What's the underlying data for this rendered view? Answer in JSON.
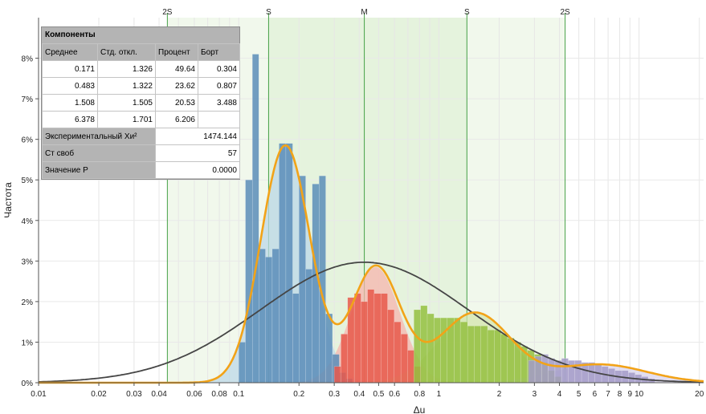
{
  "chart_data": {
    "type": "bar",
    "xlabel": "Δu",
    "ylabel": "Частота",
    "x_scale": "log",
    "xlim": [
      0.01,
      21
    ],
    "ylim": [
      0,
      9
    ],
    "y_unit": "%",
    "x_ticks": [
      {
        "v": 0.01,
        "label": "0.01"
      },
      {
        "v": 0.02,
        "label": "0.02"
      },
      {
        "v": 0.03,
        "label": "0.03"
      },
      {
        "v": 0.04,
        "label": "0.04"
      },
      {
        "v": 0.06,
        "label": "0.06"
      },
      {
        "v": 0.08,
        "label": "0.08"
      },
      {
        "v": 0.1,
        "label": "0.1"
      },
      {
        "v": 0.2,
        "label": "0.2"
      },
      {
        "v": 0.3,
        "label": "0.3"
      },
      {
        "v": 0.4,
        "label": "0.4"
      },
      {
        "v": 0.5,
        "label": "0.5"
      },
      {
        "v": 0.6,
        "label": "0.6"
      },
      {
        "v": 0.8,
        "label": "0.8"
      },
      {
        "v": 1,
        "label": "1"
      },
      {
        "v": 2,
        "label": "2"
      },
      {
        "v": 3,
        "label": "3"
      },
      {
        "v": 4,
        "label": "4"
      },
      {
        "v": 5,
        "label": "5"
      },
      {
        "v": 6,
        "label": "6"
      },
      {
        "v": 7,
        "label": "7"
      },
      {
        "v": 8,
        "label": "8"
      },
      {
        "v": 9,
        "label": "9"
      },
      {
        "v": 10,
        "label": "10"
      },
      {
        "v": 20,
        "label": "20"
      }
    ],
    "y_ticks": [
      {
        "v": 0,
        "label": "0%"
      },
      {
        "v": 1,
        "label": "1%"
      },
      {
        "v": 2,
        "label": "2%"
      },
      {
        "v": 3,
        "label": "3%"
      },
      {
        "v": 4,
        "label": "4%"
      },
      {
        "v": 5,
        "label": "5%"
      },
      {
        "v": 6,
        "label": "6%"
      },
      {
        "v": 7,
        "label": "7%"
      },
      {
        "v": 8,
        "label": "8%"
      }
    ],
    "top_markers": [
      {
        "label": "2S",
        "x": 0.044
      },
      {
        "label": "S",
        "x": 0.141
      },
      {
        "label": "M",
        "x": 0.424
      },
      {
        "label": "S",
        "x": 1.38
      },
      {
        "label": "2S",
        "x": 4.27
      }
    ],
    "band_2s": [
      0.044,
      4.27
    ],
    "band_1s": [
      0.141,
      1.38
    ],
    "colors": {
      "blue_bar": "#5b8db8",
      "blue_fill": "#bcd8e8",
      "red_bar": "#e8584a",
      "red_fill": "#f6b5ad",
      "green_bar": "#94c040",
      "green_fill": "#d3e5ac",
      "purple_bar": "#a39bc8",
      "purple_fill": "#d8d3ec",
      "sum_curve": "#f2a318",
      "overall_curve": "#454545",
      "band_2s": "#f1f8ec",
      "band_1s": "#e5f3dd",
      "marker_line": "#46a046"
    },
    "components": [
      {
        "mean": 0.171,
        "sd": 1.326,
        "weight": 49.64,
        "color": "blue",
        "bars": [
          [
            0.1,
            0.108,
            1.0
          ],
          [
            0.108,
            0.117,
            5.0
          ],
          [
            0.117,
            0.126,
            8.1
          ],
          [
            0.126,
            0.136,
            3.3
          ],
          [
            0.136,
            0.147,
            3.1
          ],
          [
            0.147,
            0.159,
            3.3
          ],
          [
            0.159,
            0.172,
            5.9
          ],
          [
            0.172,
            0.186,
            5.9
          ],
          [
            0.186,
            0.2,
            2.2
          ],
          [
            0.2,
            0.216,
            5.1
          ],
          [
            0.216,
            0.233,
            2.8
          ],
          [
            0.233,
            0.252,
            4.9
          ],
          [
            0.252,
            0.272,
            5.1
          ],
          [
            0.272,
            0.294,
            1.7
          ],
          [
            0.294,
            0.318,
            0.7
          ],
          [
            0.318,
            0.343,
            0.25
          ],
          [
            0.343,
            0.37,
            0.1
          ]
        ]
      },
      {
        "mean": 0.483,
        "sd": 1.322,
        "weight": 23.62,
        "color": "red",
        "bars": [
          [
            0.3,
            0.324,
            0.4
          ],
          [
            0.324,
            0.35,
            1.2
          ],
          [
            0.35,
            0.378,
            2.1
          ],
          [
            0.378,
            0.408,
            2.2
          ],
          [
            0.408,
            0.44,
            2.0
          ],
          [
            0.44,
            0.475,
            2.3
          ],
          [
            0.475,
            0.513,
            2.2
          ],
          [
            0.513,
            0.554,
            2.2
          ],
          [
            0.554,
            0.598,
            1.8
          ],
          [
            0.598,
            0.646,
            1.5
          ],
          [
            0.646,
            0.698,
            1.2
          ],
          [
            0.698,
            0.754,
            0.8
          ],
          [
            0.754,
            0.814,
            0.4
          ]
        ]
      },
      {
        "mean": 1.508,
        "sd": 1.505,
        "weight": 20.53,
        "color": "green",
        "bars": [
          [
            0.75,
            0.81,
            1.8
          ],
          [
            0.81,
            0.875,
            1.9
          ],
          [
            0.875,
            0.945,
            1.7
          ],
          [
            0.945,
            1.02,
            1.6
          ],
          [
            1.02,
            1.1,
            1.6
          ],
          [
            1.1,
            1.19,
            1.6
          ],
          [
            1.19,
            1.28,
            1.6
          ],
          [
            1.28,
            1.39,
            1.5
          ],
          [
            1.39,
            1.5,
            1.4
          ],
          [
            1.5,
            1.62,
            1.4
          ],
          [
            1.62,
            1.75,
            1.4
          ],
          [
            1.75,
            1.89,
            1.3
          ],
          [
            1.89,
            2.04,
            1.3
          ],
          [
            2.04,
            2.2,
            1.2
          ],
          [
            2.2,
            2.38,
            1.1
          ],
          [
            2.38,
            2.57,
            1.0
          ],
          [
            2.57,
            2.77,
            0.9
          ],
          [
            2.77,
            3.0,
            0.8
          ],
          [
            3.0,
            3.24,
            0.7
          ],
          [
            3.24,
            3.5,
            0.5
          ],
          [
            3.5,
            3.78,
            0.3
          ],
          [
            3.78,
            4.08,
            0.15
          ]
        ]
      },
      {
        "mean": 6.378,
        "sd": 1.701,
        "weight": 6.206,
        "color": "purple",
        "bars": [
          [
            2.8,
            3.02,
            0.55
          ],
          [
            3.02,
            3.26,
            0.65
          ],
          [
            3.26,
            3.52,
            0.7
          ],
          [
            3.52,
            3.8,
            0.6
          ],
          [
            3.8,
            4.1,
            0.55
          ],
          [
            4.1,
            4.43,
            0.6
          ],
          [
            4.43,
            4.78,
            0.55
          ],
          [
            4.78,
            5.16,
            0.55
          ],
          [
            5.16,
            5.57,
            0.5
          ],
          [
            5.57,
            6.02,
            0.5
          ],
          [
            6.02,
            6.5,
            0.45
          ],
          [
            6.5,
            7.02,
            0.4
          ],
          [
            7.02,
            7.58,
            0.35
          ],
          [
            7.58,
            8.19,
            0.3
          ],
          [
            8.19,
            8.84,
            0.3
          ],
          [
            8.84,
            9.55,
            0.25
          ],
          [
            9.55,
            10.3,
            0.2
          ],
          [
            10.3,
            11.1,
            0.15
          ],
          [
            11.1,
            12.0,
            0.1
          ]
        ]
      }
    ],
    "overall_fit": {
      "mean": 0.424,
      "sd": 3.3,
      "peak": 2.97
    }
  },
  "stats": {
    "title": "Компоненты",
    "headers": [
      "Среднее",
      "Стд. откл.",
      "Процент",
      "Борт"
    ],
    "rows": [
      [
        "0.171",
        "1.326",
        "49.64",
        "0.304"
      ],
      [
        "0.483",
        "1.322",
        "23.62",
        "0.807"
      ],
      [
        "1.508",
        "1.505",
        "20.53",
        "3.488"
      ],
      [
        "6.378",
        "1.701",
        "6.206",
        ""
      ]
    ],
    "chi_label": "Экспериментальный Хи²",
    "chi_value": "1474.144",
    "df_label": "Ст своб",
    "df_value": "57",
    "p_label": "Значение P",
    "p_value": "0.0000"
  }
}
